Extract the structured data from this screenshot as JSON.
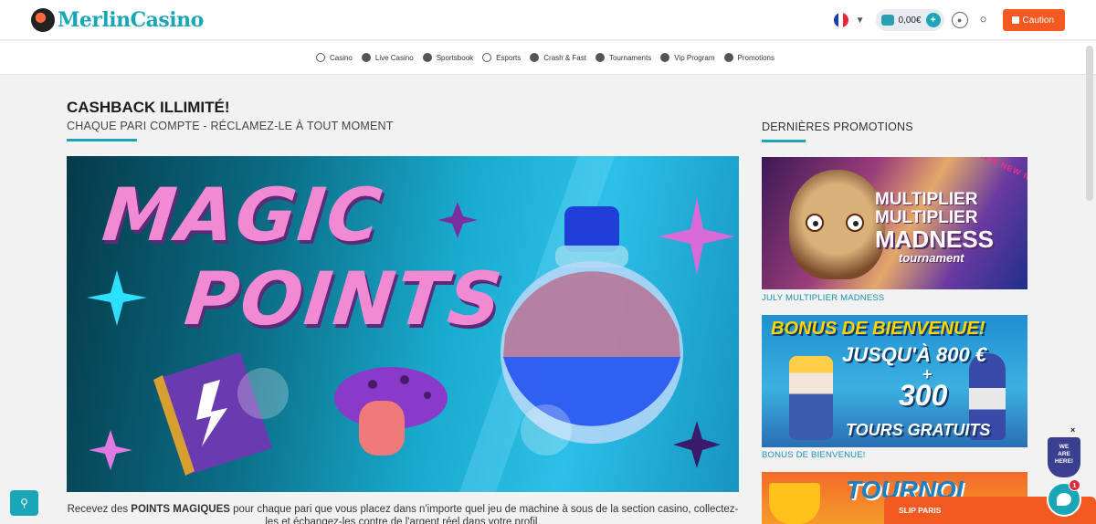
{
  "header": {
    "brand": "MerlinCasino",
    "language_flag": "fr",
    "balance": "0,00€",
    "add_funds_symbol": "+",
    "caution_label": "Caution"
  },
  "nav": {
    "items": [
      {
        "label": "Casino",
        "icon": "casino-chip-icon"
      },
      {
        "label": "Live Casino",
        "icon": "live-icon"
      },
      {
        "label": "Sportsbook",
        "icon": "ball-icon"
      },
      {
        "label": "Esports",
        "icon": "controller-icon"
      },
      {
        "label": "Crash & Fast",
        "icon": "rocket-icon"
      },
      {
        "label": "Tournaments",
        "icon": "trophy-icon"
      },
      {
        "label": "Vip Program",
        "icon": "crown-icon"
      },
      {
        "label": "Promotions",
        "icon": "gift-icon"
      }
    ]
  },
  "main": {
    "title": "CASHBACK ILLIMITÉ!",
    "subtitle": "CHAQUE PARI COMPTE - RÉCLAMEZ-LE À TOUT MOMENT",
    "banner": {
      "line1": "MAGIC",
      "line2": "POINTS"
    },
    "description_before": "Recevez des ",
    "description_bold": "POINTS MAGIQUES",
    "description_after": " pour chaque pari que vous placez dans n'importe quel jeu de machine à sous de la section casino, collectez-les et échangez-les contre de l'argent réel dans votre profil."
  },
  "sidebar": {
    "title": "DERNIÈRES PROMOTIONS",
    "promos": [
      {
        "caption": "JULY MULTIPLIER MADNESS",
        "ribbon": "NEW NEW NE",
        "line1": "MULTIPLIER",
        "line2": "MULTIPLIER",
        "line3": "MADNESS",
        "line4": "tournament"
      },
      {
        "caption": "BONUS DE BIENVENUE!",
        "line1": "BONUS DE BIENVENUE!",
        "line2": "JUSQU'À 800 €",
        "plus": "+",
        "line3": "300",
        "line4": "TOURS GRATUITS"
      },
      {
        "line1": "TOURNOI"
      }
    ]
  },
  "widgets": {
    "we_are_here": [
      "WE",
      "ARE",
      "HERE!"
    ],
    "close": "×",
    "slip_label": "SLIP PARIS",
    "chat_badge": "1"
  },
  "colors": {
    "accent": "#1aa6b7",
    "cta": "#f25a22",
    "banner_text": "#f28ad3"
  }
}
